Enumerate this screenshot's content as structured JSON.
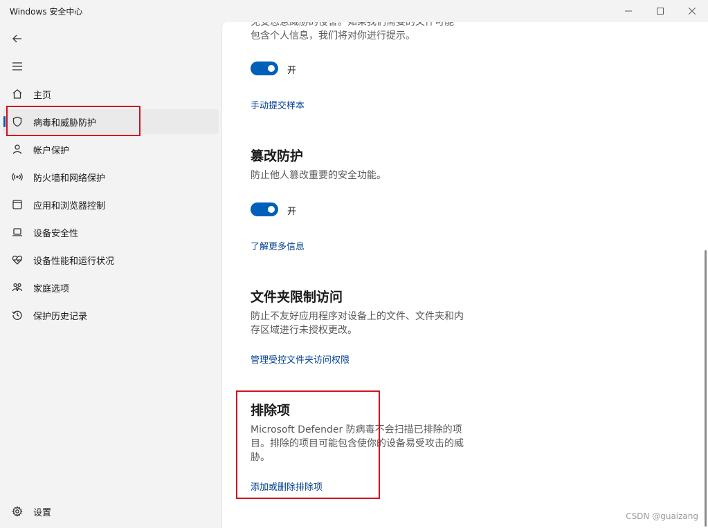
{
  "window": {
    "title": "Windows 安全中心"
  },
  "sidebar": {
    "items": [
      {
        "label": "主页",
        "icon": "home-icon"
      },
      {
        "label": "病毒和威胁防护",
        "icon": "shield-icon",
        "active": true
      },
      {
        "label": "帐户保护",
        "icon": "person-icon"
      },
      {
        "label": "防火墙和网络保护",
        "icon": "wifi-icon"
      },
      {
        "label": "应用和浏览器控制",
        "icon": "app-window-icon"
      },
      {
        "label": "设备安全性",
        "icon": "laptop-icon"
      },
      {
        "label": "设备性能和运行状况",
        "icon": "heart-pulse-icon"
      },
      {
        "label": "家庭选项",
        "icon": "family-icon"
      },
      {
        "label": "保护历史记录",
        "icon": "history-icon"
      }
    ],
    "settings_label": "设置"
  },
  "main": {
    "clipped_text": "免受恶意威胁的侵害。如果我们需要的文件可能\n包含个人信息，我们将对你进行提示。",
    "sample_toggle_label": "开",
    "sample_link": "手动提交样本",
    "tamper": {
      "title": "篡改防护",
      "desc": "防止他人篡改重要的安全功能。",
      "toggle_label": "开",
      "link": "了解更多信息"
    },
    "folder": {
      "title": "文件夹限制访问",
      "desc": "防止不友好应用程序对设备上的文件、文件夹和内存区域进行未授权更改。",
      "link": "管理受控文件夹访问权限"
    },
    "exclusions": {
      "title": "排除项",
      "desc": "Microsoft Defender 防病毒不会扫描已排除的项目。排除的项目可能包含使你的设备易受攻击的威胁。",
      "link": "添加或删除排除项"
    }
  },
  "watermark": "CSDN @guaizang",
  "colors": {
    "accent": "#005fb8",
    "link": "#003e92",
    "highlight": "#d20f1e"
  }
}
